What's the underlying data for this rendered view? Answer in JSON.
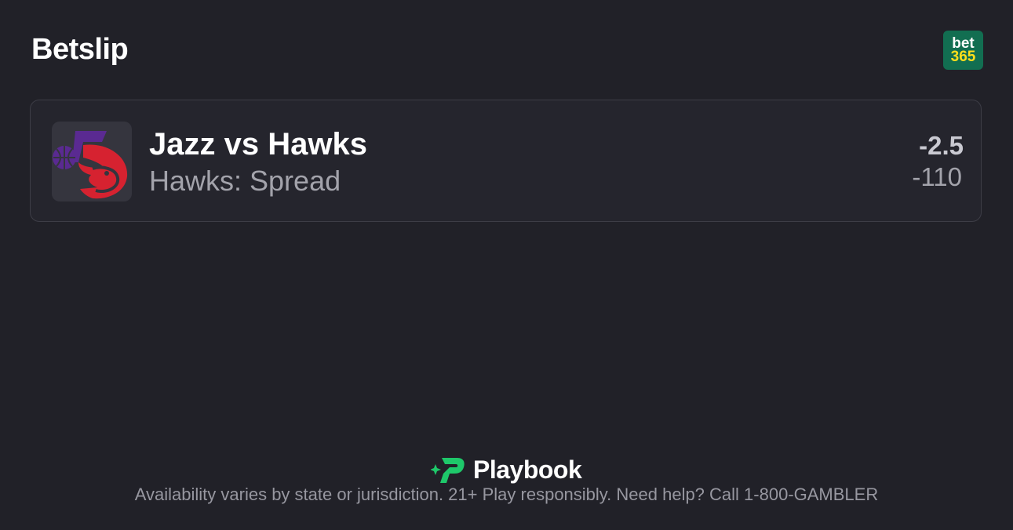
{
  "header": {
    "title": "Betslip",
    "sportsbook_logo": {
      "line1": "bet",
      "line2": "365",
      "name": "bet365-logo"
    }
  },
  "bet": {
    "matchup": "Jazz vs Hawks",
    "market": "Hawks: Spread",
    "line": "-2.5",
    "odds": "-110",
    "team_logos": [
      "utah-jazz-logo-icon",
      "atlanta-hawks-logo-icon"
    ]
  },
  "footer": {
    "brand": "Playbook",
    "disclaimer": "Availability varies by state or jurisdiction. 21+ Play responsibly. Need help? Call 1-800-GAMBLER"
  },
  "colors": {
    "background": "#212128",
    "card": "#25252d",
    "bet365_green": "#126e51",
    "bet365_yellow": "#ffdf1b",
    "jazz_purple": "#5a2a91",
    "hawks_red": "#d62230",
    "playbook_green": "#1ec86a"
  }
}
